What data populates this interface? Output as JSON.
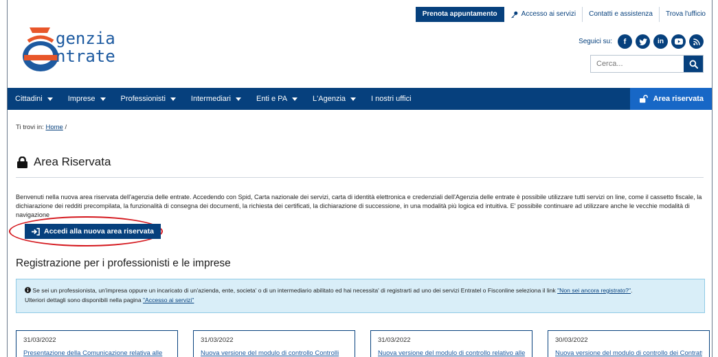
{
  "utility_bar": {
    "prenota": "Prenota appuntamento",
    "accesso": "Accesso ai servizi",
    "contatti": "Contatti e assistenza",
    "trova": "Trova l'ufficio"
  },
  "logo": {
    "line1": "genzia",
    "line2": "ntrate"
  },
  "social": {
    "label": "Seguici su:",
    "icons": [
      "facebook-icon",
      "twitter-icon",
      "linkedin-icon",
      "youtube-icon",
      "rss-icon"
    ]
  },
  "search": {
    "placeholder": "Cerca..."
  },
  "nav": {
    "items": [
      "Cittadini",
      "Imprese",
      "Professionisti",
      "Intermediari",
      "Enti e PA",
      "L'Agenzia",
      "I nostri uffici"
    ],
    "area_riservata": "Area riservata"
  },
  "breadcrumb": {
    "prefix": "Ti trovi in:",
    "home": "Home",
    "sep": "/"
  },
  "page": {
    "title": "Area Riservata",
    "intro": "Benvenuti nella nuova area riservata dell'agenzia delle entrate. Accedendo con Spid, Carta nazionale dei servizi, carta di identità elettronica e credenziali dell'Agenzia delle entrate è possibile utilizzare tutti servizi on line, come il cassetto fiscale, la dichiarazione dei redditi precompilata, la funzionalità di consegna dei documenti, la richiesta dei certificati, la dichiarazione di successione, in una modalità più logica ed intuitiva. E' possibile continuare ad utilizzare anche le vecchie modalità di navigazione",
    "cta": "Accedi alla nuova area riservata",
    "section_title": "Registrazione per i professionisti e le imprese"
  },
  "info": {
    "text1": "Se sei un professionista, un'impresa oppure un incaricato di un'azienda, ente, societa' o di un intermediario abilitato ed hai necessita' di registrarti ad uno dei servizi Entratel o Fisconline seleziona il link",
    "link1": "\"Non sei ancora registrato?\"",
    "text1_end": ".",
    "text2": "Ulteriori dettagli sono disponibili nella pagina",
    "link2": "\"Accesso ai servizi\"",
    "text2_end": ""
  },
  "cards": [
    {
      "date": "31/03/2022",
      "title": "Presentazione della Comunicazione relativa alle"
    },
    {
      "date": "31/03/2022",
      "title": "Nuova versione del modulo di controllo Controlli"
    },
    {
      "date": "31/03/2022",
      "title": "Nuova versione del modulo di controllo relativo alle"
    },
    {
      "date": "30/03/2022",
      "title": "Nuova versione del modulo di controllo dei Contratti di"
    }
  ],
  "colors": {
    "brand": "#06407d",
    "accent": "#1767c6",
    "highlight": "#d4161c",
    "info_bg": "#d9eef8"
  }
}
